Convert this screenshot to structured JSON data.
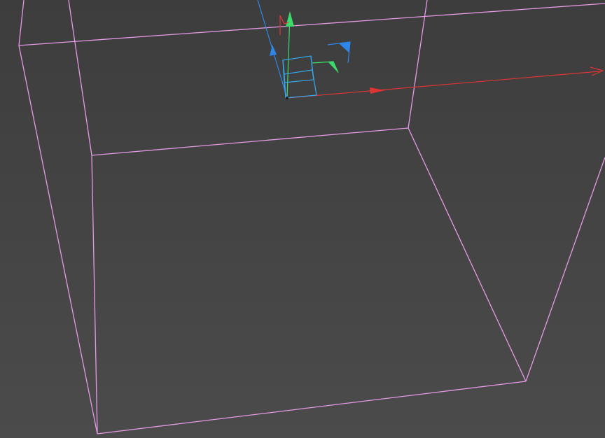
{
  "colors": {
    "viewport_bg_top": "#3d3d3d",
    "viewport_bg_bottom": "#4b4b4b",
    "selection_wire": "#e59ae5",
    "axis_x": "#e03434",
    "axis_y": "#3bdc6b",
    "axis_z": "#2f86e6",
    "handle_cube": "#35a8ee"
  },
  "viewport": {
    "selected_object": "box-wireframe",
    "tool": "move",
    "gizmo_axes": [
      "x",
      "y",
      "z"
    ]
  }
}
